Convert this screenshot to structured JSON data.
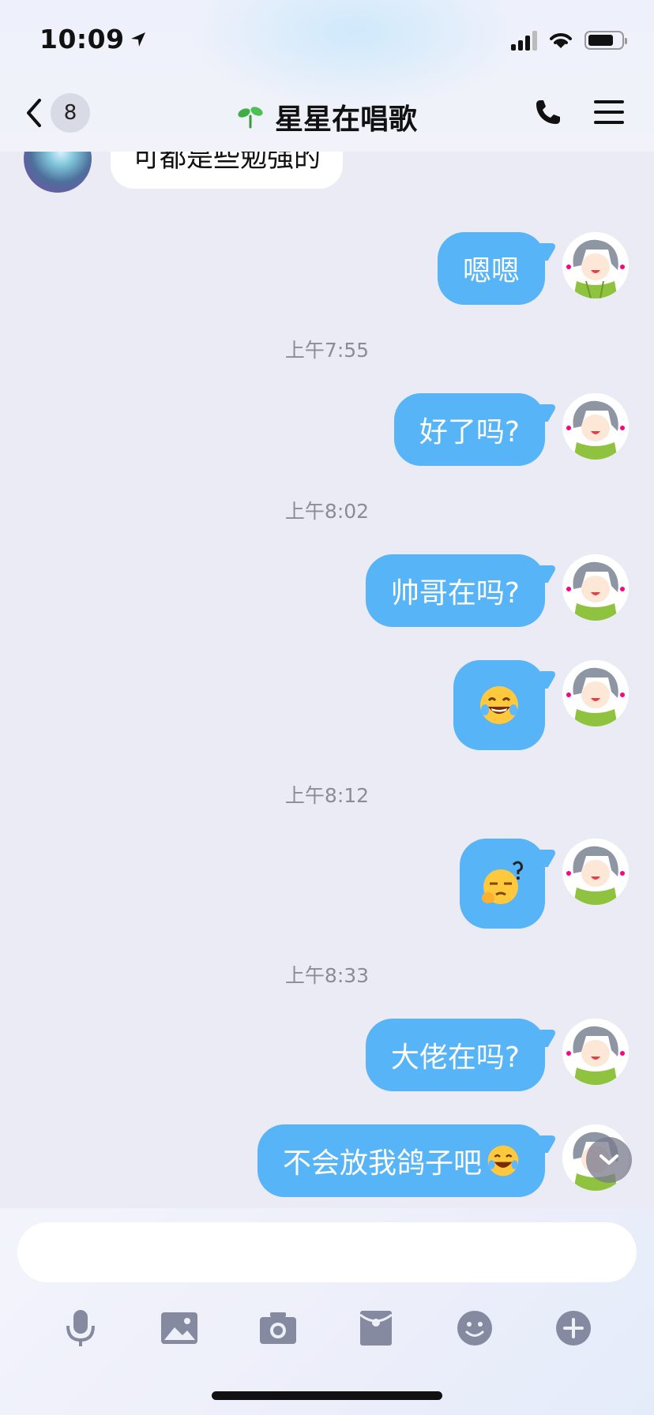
{
  "status": {
    "time": "10:09"
  },
  "header": {
    "back_count": "8",
    "title": "星星在唱歌"
  },
  "peer_message": {
    "text": "可都是些勉强的"
  },
  "messages": [
    {
      "text": "嗯嗯"
    },
    {
      "timestamp": "上午7:55",
      "text": "好了吗?"
    },
    {
      "timestamp": "上午8:02",
      "text": "帅哥在吗?"
    },
    {
      "emoji": "laughing-tears"
    },
    {
      "timestamp": "上午8:12",
      "emoji": "sleepy-question"
    },
    {
      "timestamp": "上午8:33",
      "text": "大佬在吗?"
    },
    {
      "text": "不会放我鸽子吧"
    }
  ],
  "timestamps": [
    "上午7:55",
    "上午8:02",
    "上午8:12",
    "上午8:33"
  ],
  "composer": {
    "placeholder": ""
  },
  "colors": {
    "bubble": "#56b4f7",
    "background": "#ebebf5"
  },
  "icons": [
    "back-icon",
    "sprout-icon",
    "phone-icon",
    "menu-icon",
    "mic-icon",
    "image-icon",
    "camera-icon",
    "red-packet-icon",
    "emoji-icon",
    "plus-icon",
    "chevron-down-icon"
  ]
}
